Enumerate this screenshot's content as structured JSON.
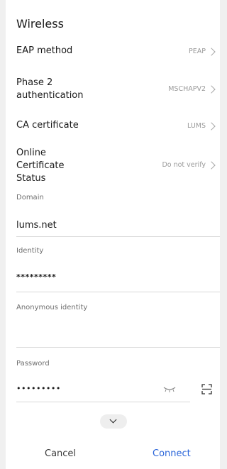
{
  "title": "Wireless",
  "rows": [
    {
      "label": "EAP method",
      "value": "PEAP"
    },
    {
      "label": "Phase 2 authentication",
      "value": "MSCHAPV2"
    },
    {
      "label": "CA certificate",
      "value": "LUMS"
    },
    {
      "label": "Online Certificate Status",
      "value": "Do not verify"
    }
  ],
  "fields": {
    "domain": {
      "label": "Domain",
      "value": "lums.net"
    },
    "identity": {
      "label": "Identity",
      "value": "*********"
    },
    "anonymous": {
      "label": "Anonymous identity",
      "value": ""
    },
    "password": {
      "label": "Password",
      "value": "•••••••••"
    }
  },
  "icons": {
    "eye": "eye-closed-icon",
    "scan": "scan-icon",
    "expand": "chevron-down-icon",
    "chevron": "chevron-right-icon"
  },
  "actions": {
    "cancel": "Cancel",
    "connect": "Connect"
  },
  "colors": {
    "accent": "#2b66d9",
    "secondary_text": "#9a9a9a",
    "background": "#ffffff"
  }
}
